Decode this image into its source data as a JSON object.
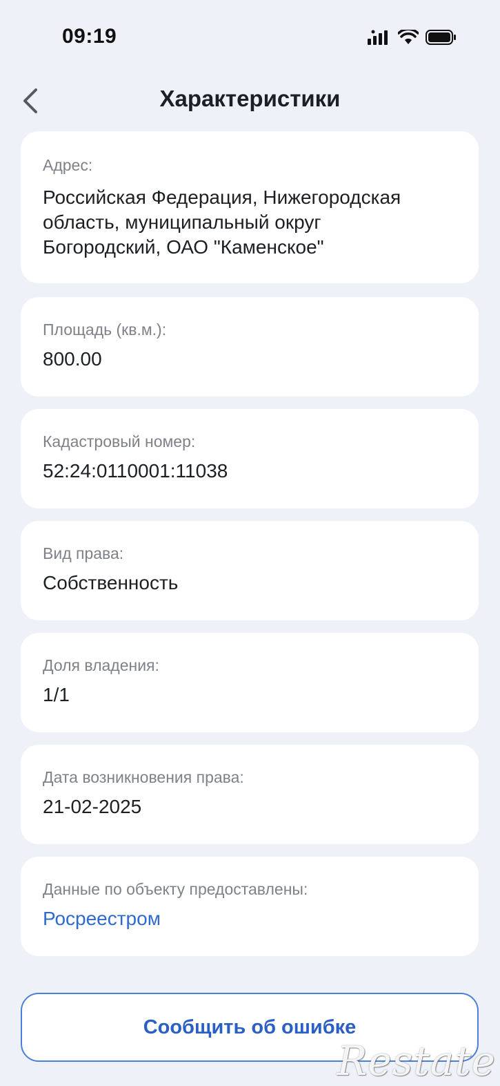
{
  "status_bar": {
    "time": "09:19",
    "icons": [
      "signal-icon",
      "wifi-icon",
      "battery-icon"
    ]
  },
  "header": {
    "back_icon": "chevron-left-icon",
    "title": "Характеристики"
  },
  "cards": {
    "address": {
      "label": "Адрес:",
      "value_line1": "Российская Федерация, Нижегородская",
      "value_line2": "область, муниципальный округ",
      "value_line3": "Богородский, ОАО \"Каменское\""
    },
    "area": {
      "label": "Площадь (кв.м.):",
      "value": "800.00"
    },
    "cadastral": {
      "label": "Кадастровый номер:",
      "value": "52:24:0110001:11038"
    },
    "right_type": {
      "label": "Вид права:",
      "value": "Собственность"
    },
    "share": {
      "label": "Доля владения:",
      "value": "1/1"
    },
    "date": {
      "label": "Дата возникновения права:",
      "value": "21-02-2025"
    },
    "source": {
      "label": "Данные по объекту предоставлены:",
      "value": "Росреестром"
    }
  },
  "actions": {
    "report_error": "Сообщить об ошибке"
  },
  "watermark": "Restate",
  "colors": {
    "background": "#eef2f8",
    "card": "#ffffff",
    "link": "#2f6ad0",
    "button_border": "#4a7fdc"
  }
}
